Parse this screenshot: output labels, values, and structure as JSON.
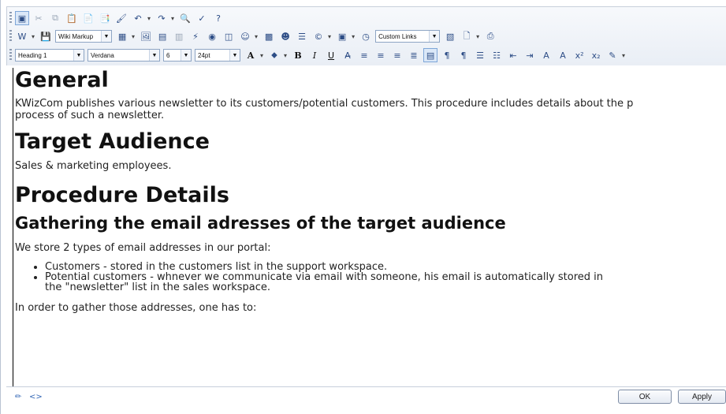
{
  "toolbar": {
    "row2": {
      "markup_select": "Wiki Markup",
      "custom_links_select": "Custom Links"
    },
    "row3": {
      "style_select": "Heading 1",
      "font_select": "Verdana",
      "size_select": "6",
      "point_select": "24pt"
    }
  },
  "content": {
    "general_heading": "General",
    "general_text_line1": "KWizCom publishes various newsletter to its customers/potential customers. This procedure includes details about the p",
    "general_text_line2": "process of such a newsletter.",
    "target_heading": "Target Audience",
    "target_text": "Sales & marketing employees.",
    "procedure_heading": "Procedure Details",
    "gathering_heading": "Gathering the email adresses of the target audience",
    "store_text": "We store 2 types of email addresses in our portal:",
    "bullets": [
      "Customers - stored in the customers list in the support workspace.",
      "Potential customers - whnever we communicate via email with someone, his email is automatically stored in",
      "the \"newsletter\" list in the sales workspace."
    ],
    "gather_text": "In order to gather those addresses, one has to:"
  },
  "footer": {
    "ok_label": "OK",
    "apply_label": "Apply"
  }
}
